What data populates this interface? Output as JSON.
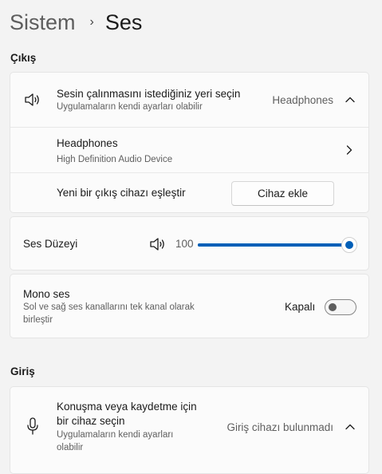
{
  "breadcrumb": {
    "parent": "Sistem",
    "separator": "›",
    "current": "Ses"
  },
  "output": {
    "section_title": "Çıkış",
    "choose": {
      "title": "Sesin çalınmasını istediğiniz yeri seçin",
      "subtitle": "Uygulamaların kendi ayarları olabilir",
      "value": "Headphones",
      "icon": "speaker-icon"
    },
    "device": {
      "name": "Headphones",
      "description": "High Definition Audio Device"
    },
    "pair": {
      "label": "Yeni bir çıkış cihazı eşleştir",
      "button": "Cihaz ekle"
    },
    "volume": {
      "label": "Ses Düzeyi",
      "value": "100",
      "level": 1.0
    },
    "mono": {
      "title": "Mono ses",
      "subtitle_line1": "Sol ve sağ ses kanallarını tek kanal olarak",
      "subtitle_line2": "birleştir",
      "state_label": "Kapalı",
      "on": false
    }
  },
  "input": {
    "section_title": "Giriş",
    "choose": {
      "title_line1": "Konuşma veya kaydetme için",
      "title_line2": "bir cihaz seçin",
      "subtitle_line1": "Uygulamaların kendi ayarları",
      "subtitle_line2": "olabilir",
      "value": "Giriş cihazı bulunmadı",
      "icon": "microphone-icon"
    }
  },
  "colors": {
    "accent": "#005fb8",
    "background": "#f3f3f3",
    "card": "#fbfbfb"
  }
}
